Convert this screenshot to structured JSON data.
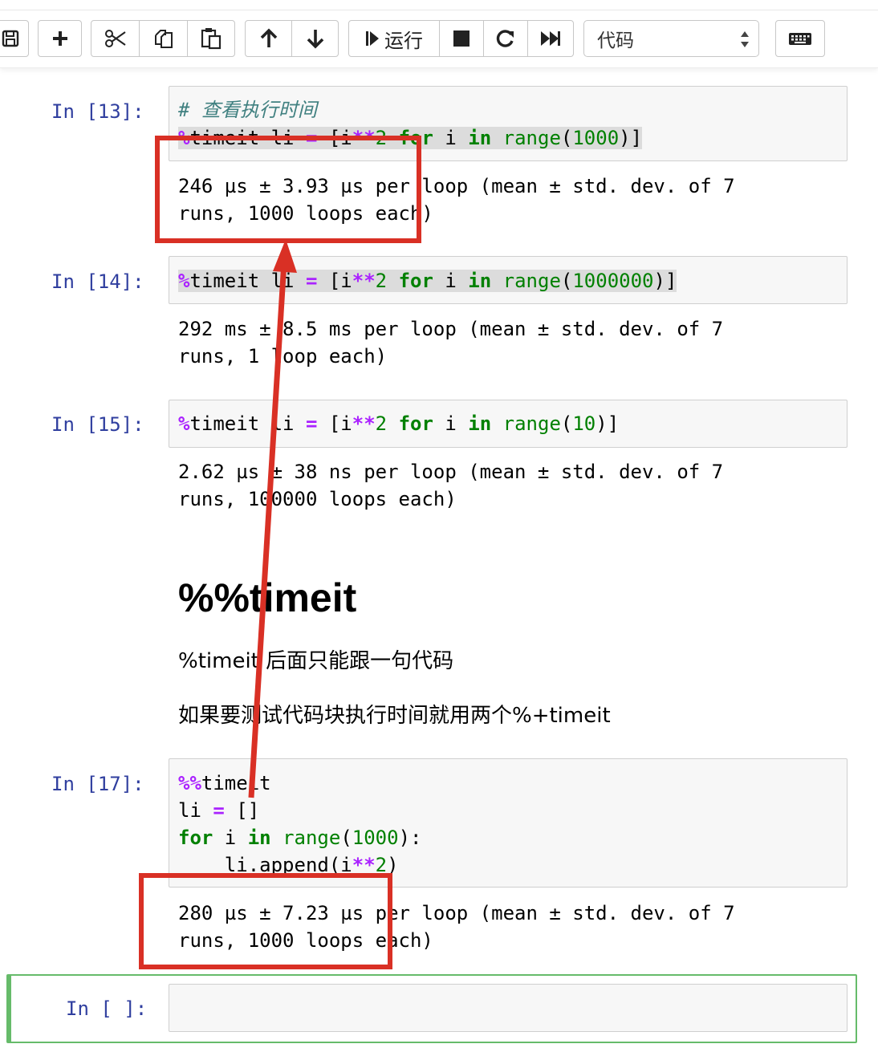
{
  "toolbar": {
    "run_label": "运行",
    "cell_type": "代码",
    "buttons": [
      "save-icon",
      "plus-icon",
      "scissors-icon",
      "copy-icon",
      "paste-icon",
      "arrow-up-icon",
      "arrow-down-icon",
      "step-icon",
      "stop-icon",
      "restart-icon",
      "fast-forward-icon",
      "keyboard-icon"
    ]
  },
  "cells": [
    {
      "prompt": "In [13]:",
      "code": [
        "# 查看执行时间",
        "%timeit li = [i**2 for i in range(1000)]"
      ],
      "output": [
        "246 µs ± 3.93 µs per loop (mean ± std. dev. of 7",
        "runs, 1000 loops each)"
      ]
    },
    {
      "prompt": "In [14]:",
      "code": [
        "%timeit li = [i**2 for i in range(1000000)]"
      ],
      "output": [
        "292 ms ± 8.5 ms per loop (mean ± std. dev. of 7",
        "runs, 1 loop each)"
      ]
    },
    {
      "prompt": "In [15]:",
      "code": [
        "%timeit li = [i**2 for i in range(10)]"
      ],
      "output": [
        "2.62 µs ± 38 ns per loop (mean ± std. dev. of 7",
        "runs, 100000 loops each)"
      ]
    },
    {
      "prompt": "In [17]:",
      "code": [
        "%%timeit",
        "li = []",
        "for i in range(1000):",
        "    li.append(i**2)"
      ],
      "output": [
        "280 µs ± 7.23 µs per loop (mean ± std. dev. of 7",
        "runs, 1000 loops each)"
      ]
    },
    {
      "prompt": "In [ ]:",
      "code": [],
      "output": []
    }
  ],
  "markdown": {
    "heading": "%%timeit",
    "para1": "%timeit 后面只能跟一句代码",
    "para2": "如果要测试代码块执行时间就用两个%+timeit"
  },
  "colors": {
    "prompt": "#303f9f",
    "keyword": "#008000",
    "magic": "#aa22ff",
    "comment": "#408080",
    "annotation": "#d93025",
    "active_cell_border": "#66bb6a"
  }
}
